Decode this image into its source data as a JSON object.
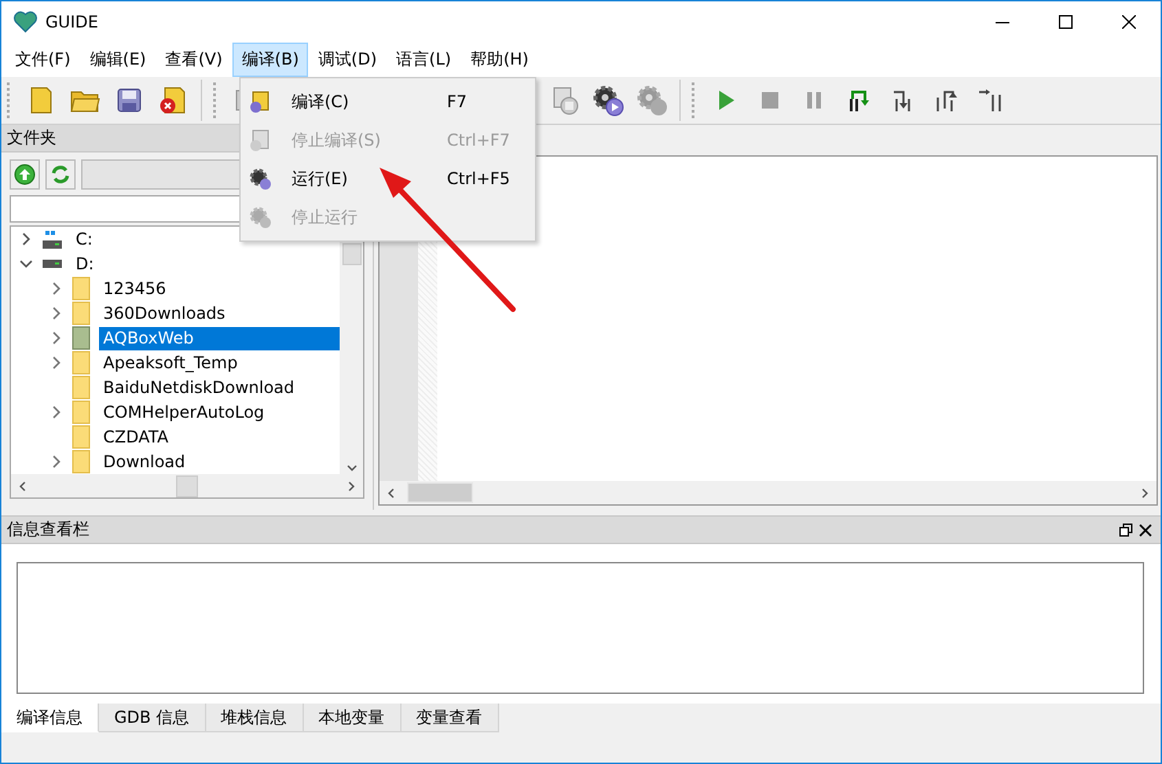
{
  "window": {
    "title": "GUIDE"
  },
  "menu_bar": [
    {
      "label": "文件(F)",
      "selected": false
    },
    {
      "label": "编辑(E)",
      "selected": false
    },
    {
      "label": "查看(V)",
      "selected": false
    },
    {
      "label": "编译(B)",
      "selected": true
    },
    {
      "label": "调试(D)",
      "selected": false
    },
    {
      "label": "语言(L)",
      "selected": false
    },
    {
      "label": "帮助(H)",
      "selected": false
    }
  ],
  "open_menu": {
    "items": [
      {
        "label": "编译(C)",
        "shortcut": "F7",
        "disabled": false,
        "kind": "compile"
      },
      {
        "label": "停止编译(S)",
        "shortcut": "Ctrl+F7",
        "disabled": true,
        "kind": "compile"
      },
      {
        "label": "运行(E)",
        "shortcut": "Ctrl+F5",
        "disabled": false,
        "kind": "run"
      },
      {
        "label": "停止运行",
        "disabled": true,
        "kind": "run"
      }
    ]
  },
  "folder_panel": {
    "title": "文件夹",
    "tree": [
      {
        "label": "C:",
        "kind": "drive",
        "expanded": false
      },
      {
        "label": "D:",
        "kind": "drive",
        "expanded": true,
        "children": [
          {
            "label": "123456",
            "kind": "folder",
            "expandable": true,
            "selected": false
          },
          {
            "label": "360Downloads",
            "kind": "folder",
            "expandable": true,
            "selected": false
          },
          {
            "label": "AQBoxWeb",
            "kind": "folder",
            "expandable": true,
            "selected": true
          },
          {
            "label": "Apeaksoft_Temp",
            "kind": "folder",
            "expandable": true,
            "selected": false
          },
          {
            "label": "BaiduNetdiskDownload",
            "kind": "folder",
            "expandable": false,
            "selected": false
          },
          {
            "label": "COMHelperAutoLog",
            "kind": "folder",
            "expandable": true,
            "selected": false
          },
          {
            "label": "CZDATA",
            "kind": "folder",
            "expandable": false,
            "selected": false
          },
          {
            "label": "Download",
            "kind": "folder",
            "expandable": true,
            "selected": false
          }
        ]
      }
    ]
  },
  "info_panel": {
    "title": "信息查看栏",
    "tabs": [
      {
        "label": "编译信息",
        "selected": true
      },
      {
        "label": "GDB 信息",
        "selected": false
      },
      {
        "label": "堆栈信息",
        "selected": false
      },
      {
        "label": "本地变量",
        "selected": false
      },
      {
        "label": "变量查看",
        "selected": false
      }
    ]
  }
}
